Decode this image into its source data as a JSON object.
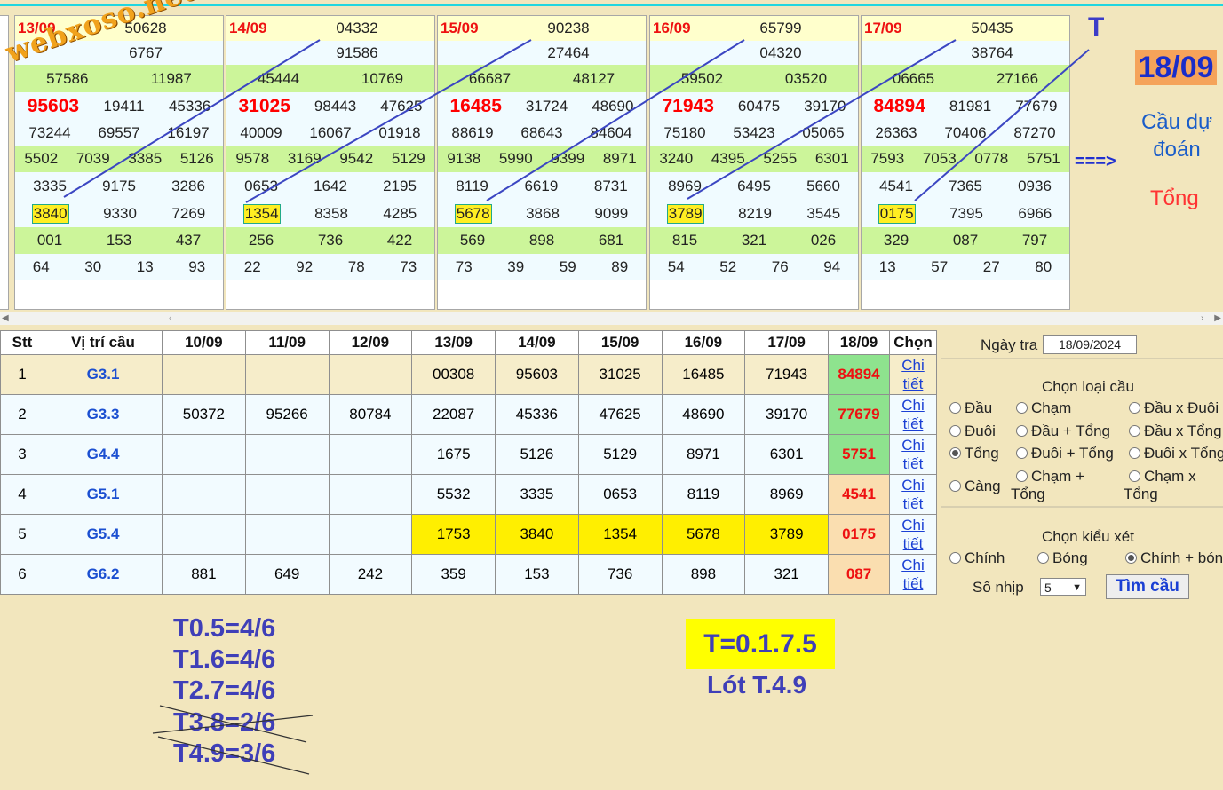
{
  "boards": [
    {
      "date": "13/09",
      "rows": [
        [
          "50628"
        ],
        [
          "",
          "6767"
        ],
        [
          "57586",
          "11987"
        ],
        [
          "95603",
          "19411",
          "45336"
        ],
        [
          "73244",
          "69557",
          "16197"
        ],
        [
          "5502",
          "7039",
          "3385",
          "5126"
        ],
        [
          "3335",
          "9175",
          "3286"
        ],
        [
          "3840",
          "9330",
          "7269"
        ],
        [
          "001",
          "153",
          "437"
        ],
        [
          "64",
          "30",
          "13",
          "93"
        ]
      ]
    },
    {
      "date": "14/09",
      "rows": [
        [
          "04332"
        ],
        [
          "91586"
        ],
        [
          "45444",
          "10769"
        ],
        [
          "31025",
          "98443",
          "47625"
        ],
        [
          "40009",
          "16067",
          "01918"
        ],
        [
          "9578",
          "3169",
          "9542",
          "5129"
        ],
        [
          "0653",
          "1642",
          "2195"
        ],
        [
          "1354",
          "8358",
          "4285"
        ],
        [
          "256",
          "736",
          "422"
        ],
        [
          "22",
          "92",
          "78",
          "73"
        ]
      ]
    },
    {
      "date": "15/09",
      "rows": [
        [
          "90238"
        ],
        [
          "27464"
        ],
        [
          "66687",
          "48127"
        ],
        [
          "16485",
          "31724",
          "48690"
        ],
        [
          "88619",
          "68643",
          "84604"
        ],
        [
          "9138",
          "5990",
          "9399",
          "8971"
        ],
        [
          "8119",
          "6619",
          "8731"
        ],
        [
          "5678",
          "3868",
          "9099"
        ],
        [
          "569",
          "898",
          "681"
        ],
        [
          "73",
          "39",
          "59",
          "89"
        ]
      ]
    },
    {
      "date": "16/09",
      "rows": [
        [
          "65799"
        ],
        [
          "04320"
        ],
        [
          "59502",
          "03520"
        ],
        [
          "71943",
          "60475",
          "39170"
        ],
        [
          "75180",
          "53423",
          "05065"
        ],
        [
          "3240",
          "4395",
          "5255",
          "6301"
        ],
        [
          "8969",
          "6495",
          "5660"
        ],
        [
          "3789",
          "8219",
          "3545"
        ],
        [
          "815",
          "321",
          "026"
        ],
        [
          "54",
          "52",
          "76",
          "94"
        ]
      ]
    },
    {
      "date": "17/09",
      "rows": [
        [
          "50435"
        ],
        [
          "38764"
        ],
        [
          "06665",
          "27166"
        ],
        [
          "84894",
          "81981",
          "77679"
        ],
        [
          "26363",
          "70406",
          "87270"
        ],
        [
          "7593",
          "7053",
          "0778",
          "5751"
        ],
        [
          "4541",
          "7365",
          "0936"
        ],
        [
          "0175",
          "7395",
          "6966"
        ],
        [
          "329",
          "087",
          "797"
        ],
        [
          "13",
          "57",
          "27",
          "80"
        ]
      ]
    }
  ],
  "watermark": "webxoso.net",
  "t_label": "T",
  "predict_date": "18/09",
  "predict_line1": "Cầu dự",
  "predict_line2": "đoán",
  "predict_arrow": "===>",
  "predict_type": "Tổng",
  "table": {
    "headers": [
      "Stt",
      "Vị trí cầu",
      "10/09",
      "11/09",
      "12/09",
      "13/09",
      "14/09",
      "15/09",
      "16/09",
      "17/09",
      "18/09",
      "Chọn"
    ],
    "rows": [
      {
        "stt": "1",
        "pos": "G3.1",
        "vals": [
          "",
          "",
          "",
          "00308",
          "95603",
          "31025",
          "16485",
          "71943"
        ],
        "pred": "84894",
        "link1": "Chi",
        "link2": "tiết"
      },
      {
        "stt": "2",
        "pos": "G3.3",
        "vals": [
          "50372",
          "95266",
          "80784",
          "22087",
          "45336",
          "47625",
          "48690",
          "39170"
        ],
        "pred": "77679",
        "link1": "Chi",
        "link2": "tiết"
      },
      {
        "stt": "3",
        "pos": "G4.4",
        "vals": [
          "",
          "",
          "",
          "1675",
          "5126",
          "5129",
          "8971",
          "6301"
        ],
        "pred": "5751",
        "link1": "Chi",
        "link2": "tiết"
      },
      {
        "stt": "4",
        "pos": "G5.1",
        "vals": [
          "",
          "",
          "",
          "5532",
          "3335",
          "0653",
          "8119",
          "8969"
        ],
        "pred": "4541",
        "link1": "Chi",
        "link2": "tiết"
      },
      {
        "stt": "5",
        "pos": "G5.4",
        "vals": [
          "",
          "",
          "",
          "1753",
          "3840",
          "1354",
          "5678",
          "3789"
        ],
        "pred": "0175",
        "link1": "Chi",
        "link2": "tiết"
      },
      {
        "stt": "6",
        "pos": "G6.2",
        "vals": [
          "881",
          "649",
          "242",
          "359",
          "153",
          "736",
          "898",
          "321"
        ],
        "pred": "087",
        "link1": "Chi",
        "link2": "tiết"
      }
    ]
  },
  "panel": {
    "date_label": "Ngày tra",
    "date_value": "18/09/2024",
    "type_title": "Chọn loại cầu",
    "opt_dau": "Đầu",
    "opt_cham": "Chạm",
    "opt_dauxduoi": "Đầu x Đuôi",
    "opt_duoi": "Đuôi",
    "opt_dautong": "Đầu + Tổng",
    "opt_dauxtong": "Đầu x Tổng",
    "opt_tong": "Tổng",
    "opt_duoitong": "Đuôi + Tổng",
    "opt_duoixtong": "Đuôi x Tổng",
    "opt_cang": "Càng",
    "opt_chamtong1": "Chạm +",
    "opt_chamtong2": "Tổng",
    "opt_chamxtong1": "Chạm x",
    "opt_chamxtong2": "Tổng",
    "kind_title": "Chọn kiểu xét",
    "opt_chinh": "Chính",
    "opt_bong": "Bóng",
    "opt_chinhbong": "Chính + bóng",
    "steps_label": "Số nhịp",
    "steps_value": "5",
    "search_button": "Tìm cầu"
  },
  "notes": [
    "T0.5=4/6",
    "T1.6=4/6",
    "T2.7=4/6",
    "T3.8=2/6",
    "T4.9=3/6"
  ],
  "result": "T=0.1.7.5",
  "lot": "Lót T.4.9"
}
